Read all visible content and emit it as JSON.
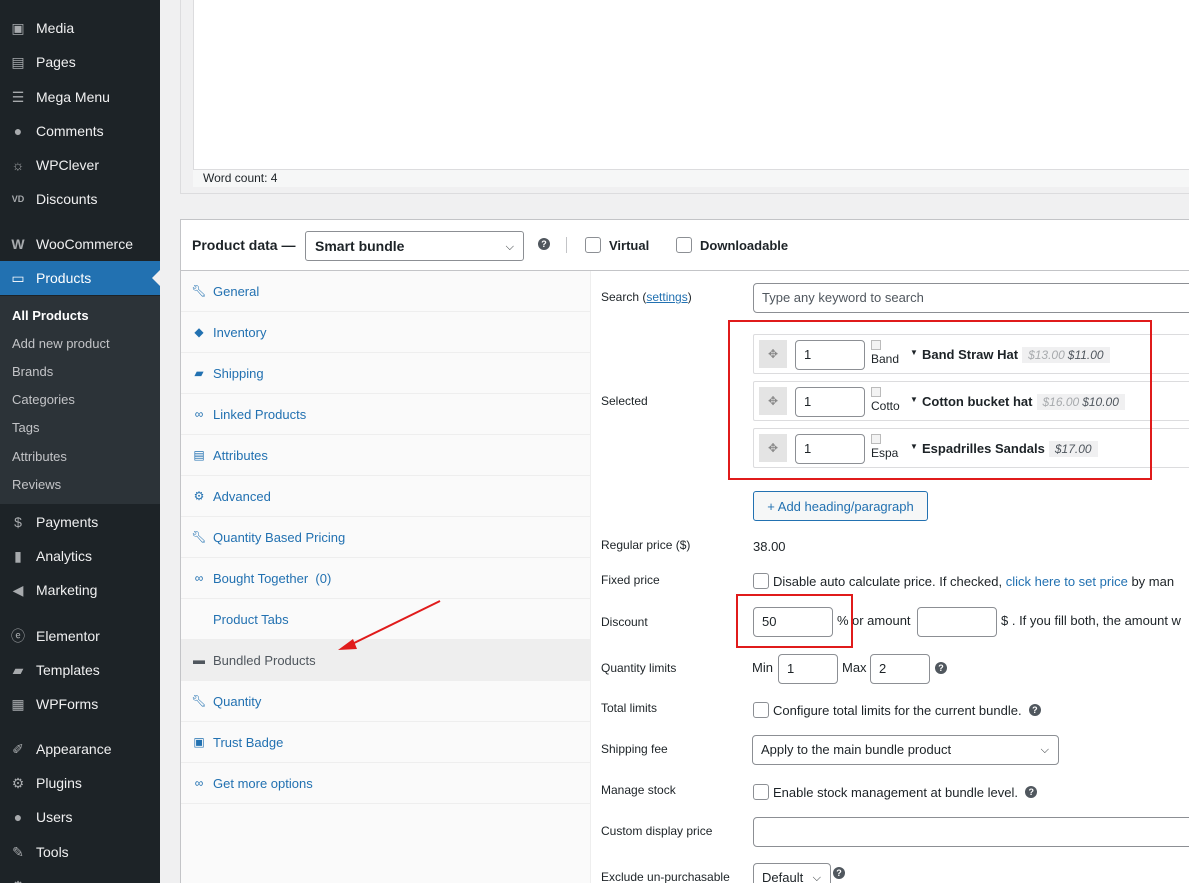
{
  "sidebar": {
    "items": [
      {
        "label": "Media",
        "icon": "media-icon"
      },
      {
        "label": "Pages",
        "icon": "pages-icon"
      },
      {
        "label": "Mega Menu",
        "icon": "mega-menu-icon"
      },
      {
        "label": "Comments",
        "icon": "comments-icon"
      },
      {
        "label": "WPClever",
        "icon": "wpclever-icon"
      },
      {
        "label": "Discounts",
        "icon": "discounts-icon"
      },
      {
        "label": "WooCommerce",
        "icon": "woocommerce-icon"
      },
      {
        "label": "Products",
        "icon": "products-icon"
      },
      {
        "label": "Payments",
        "icon": "payments-icon"
      },
      {
        "label": "Analytics",
        "icon": "analytics-icon"
      },
      {
        "label": "Marketing",
        "icon": "marketing-icon"
      },
      {
        "label": "Elementor",
        "icon": "elementor-icon"
      },
      {
        "label": "Templates",
        "icon": "templates-icon"
      },
      {
        "label": "WPForms",
        "icon": "wpforms-icon"
      },
      {
        "label": "Appearance",
        "icon": "appearance-icon"
      },
      {
        "label": "Plugins",
        "icon": "plugins-icon"
      },
      {
        "label": "Users",
        "icon": "users-icon"
      },
      {
        "label": "Tools",
        "icon": "tools-icon"
      }
    ],
    "submenu": [
      "All Products",
      "Add new product",
      "Brands",
      "Categories",
      "Tags",
      "Attributes",
      "Reviews"
    ]
  },
  "editor": {
    "word_count": "Word count: 4"
  },
  "product_data": {
    "title": "Product data —",
    "type_value": "Smart bundle",
    "virtual_label": "Virtual",
    "downloadable_label": "Downloadable",
    "tabs": [
      "General",
      "Inventory",
      "Shipping",
      "Linked Products",
      "Attributes",
      "Advanced",
      "Quantity Based Pricing",
      "Bought Together  (0)",
      "Product Tabs",
      "Bundled Products",
      "Quantity",
      "Trust Badge",
      "Get more options"
    ]
  },
  "fields": {
    "search_label": "Search (",
    "search_settings_link": "settings",
    "search_label_close": ")",
    "search_placeholder": "Type any keyword to search",
    "selected_label": "Selected",
    "selected_items": [
      {
        "qty": "1",
        "thumb_alt": "Band",
        "name": "Band Straw Hat",
        "old_price": "$13.00",
        "price": "$11.00"
      },
      {
        "qty": "1",
        "thumb_alt": "Cotto",
        "name": "Cotton bucket hat",
        "old_price": "$16.00",
        "price": "$10.00"
      },
      {
        "qty": "1",
        "thumb_alt": "Espa",
        "name": "Espadrilles Sandals",
        "old_price": "",
        "price": "$17.00"
      }
    ],
    "add_heading_button": "+ Add heading/paragraph",
    "regular_price_label": "Regular price ($)",
    "regular_price_value": "38.00",
    "fixed_price_label": "Fixed price",
    "fixed_price_text": "Disable auto calculate price. If checked,",
    "fixed_price_link": "click here to set price",
    "fixed_price_tail": "by man",
    "discount_label": "Discount",
    "discount_value": "50",
    "discount_percent": "%",
    "discount_or_amount": "or amount",
    "discount_tail": "$ . If you fill both, the amount w",
    "qty_limits_label": "Quantity limits",
    "min_label": "Min",
    "min_value": "1",
    "max_label": "Max",
    "max_value": "2",
    "total_limits_label": "Total limits",
    "total_limits_text": "Configure total limits for the current bundle.",
    "shipping_fee_label": "Shipping fee",
    "shipping_fee_value": "Apply to the main bundle product",
    "manage_stock_label": "Manage stock",
    "manage_stock_text": "Enable stock management at bundle level.",
    "custom_display_price_label": "Custom display price",
    "exclude_label": "Exclude un-purchasable",
    "exclude_value": "Default"
  },
  "colors": {
    "accent": "#2271b1",
    "sidebar_bg": "#1d2327",
    "annotation": "#e01b1b"
  }
}
